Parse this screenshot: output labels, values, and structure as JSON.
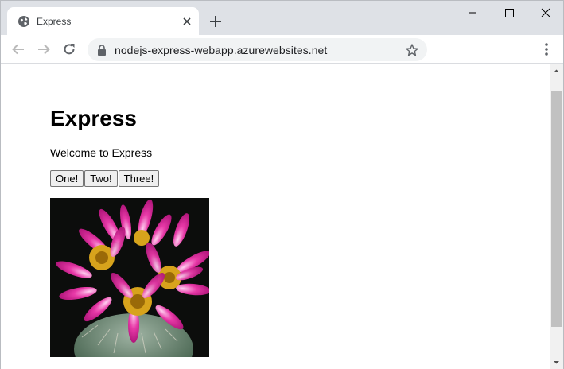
{
  "browser": {
    "tab": {
      "title": "Express",
      "favicon": "globe-icon"
    },
    "new_tab_icon": "plus-icon",
    "window_controls": [
      "minimize-icon",
      "maximize-icon",
      "close-icon"
    ],
    "address_bar": {
      "url": "nodejs-express-webapp.azurewebsites.net",
      "security_icon": "lock-icon"
    },
    "colors": {
      "tabstrip": "#dee1e6",
      "omnibox": "#f1f3f4"
    }
  },
  "page": {
    "heading": "Express",
    "welcome": "Welcome to Express",
    "buttons": [
      {
        "label": "One!"
      },
      {
        "label": "Two!"
      },
      {
        "label": "Three!"
      }
    ],
    "image": {
      "subject": "pink cactus flower"
    }
  }
}
